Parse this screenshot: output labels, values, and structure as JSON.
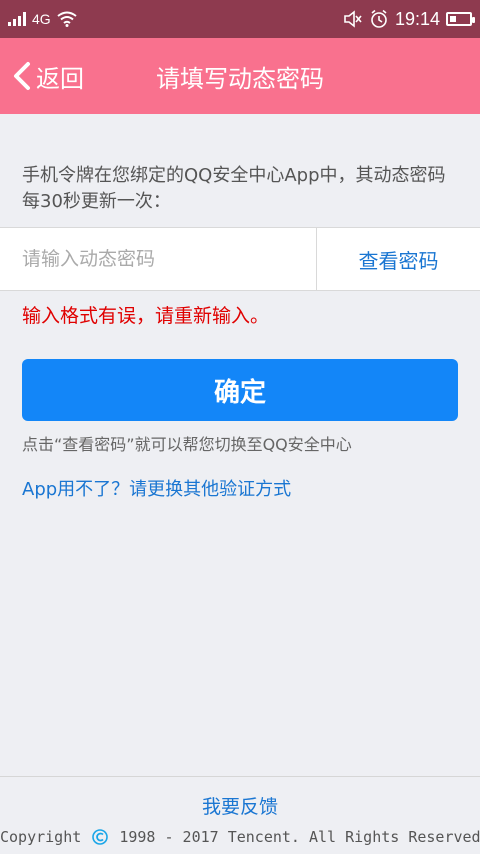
{
  "status_bar": {
    "network": "4G",
    "time": "19:14"
  },
  "header": {
    "back_label": "返回",
    "title": "请填写动态密码"
  },
  "description": "手机令牌在您绑定的QQ安全中心App中，其动态密码每30秒更新一次：",
  "input": {
    "placeholder": "请输入动态密码",
    "value": ""
  },
  "view_password_label": "查看密码",
  "error_message": "输入格式有误，请重新输入。",
  "confirm_label": "确定",
  "hint": "点击“查看密码”就可以帮您切换至QQ安全中心",
  "alt_link": "App用不了？请更换其他验证方式",
  "footer": {
    "feedback_label": "我要反馈",
    "copyright_prefix": "Copyright",
    "copyright_suffix": "1998 - 2017 Tencent. All Rights Reserved."
  },
  "colors": {
    "status_bar": "#8e3a4f",
    "header": "#f9718e",
    "primary_button": "#1386f8",
    "link": "#1a76d2",
    "error": "#e00000"
  }
}
